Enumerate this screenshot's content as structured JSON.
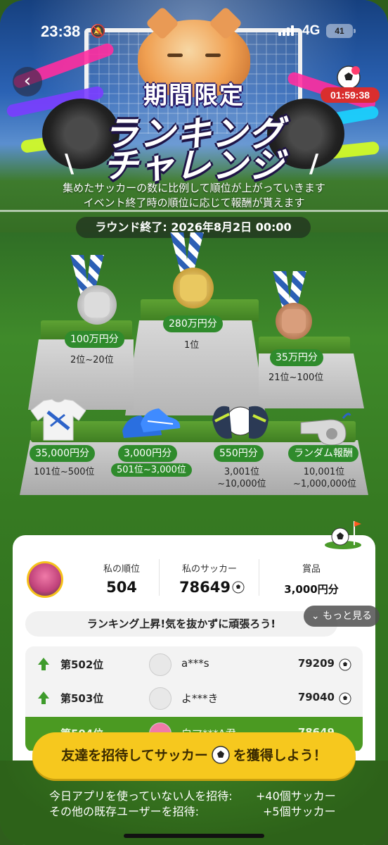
{
  "status_bar": {
    "time": "23:38",
    "network": "4G",
    "battery": "41"
  },
  "header": {
    "countdown": "01:59:38",
    "title_top": "期間限定",
    "title_line1": "ランキング",
    "title_line2": "チャレンジ",
    "desc_line1": "集めたサッカーの数に比例して順位が上がっていきます",
    "desc_line2": "イベント終了時の順位に応じて報酬が貰えます",
    "round_end": "ラウンド終了: 2026年8月2日 00:00"
  },
  "podium": [
    {
      "prize": "280万円分",
      "rank": "1位"
    },
    {
      "prize": "100万円分",
      "rank": "2位~20位"
    },
    {
      "prize": "35万円分",
      "rank": "21位~100位"
    }
  ],
  "rewards": [
    {
      "prize": "35,000円分",
      "rank": "101位~500位"
    },
    {
      "prize": "3,000円分",
      "rank": "501位~3,000位"
    },
    {
      "prize": "550円分",
      "rank_line1": "3,001位",
      "rank_line2": "~10,000位"
    },
    {
      "prize": "ランダム報酬",
      "rank_line1": "10,001位",
      "rank_line2": "~1,000,000位"
    }
  ],
  "my_status": {
    "rank_label": "私の順位",
    "rank_value": "504",
    "soccer_label": "私のサッカー",
    "soccer_value": "78649",
    "prize_label": "賞品",
    "prize_value": "3,000円分"
  },
  "cheer_message": "ランキング上昇!気を抜かずに頑張ろう!",
  "more_button": "もっと見る",
  "leaderboard": [
    {
      "rank": "第502位",
      "name": "a***s",
      "score": "79209"
    },
    {
      "rank": "第503位",
      "name": "よ***き",
      "score": "79040"
    },
    {
      "rank": "第504位",
      "name": "白マ***A君",
      "score": "78649"
    }
  ],
  "invite": {
    "before": "友達を招待してサッカー",
    "after": "を獲得しよう！"
  },
  "bonuses": [
    {
      "label": "今日アプリを使っていない人を招待:",
      "value": "+40個サッカー"
    },
    {
      "label": "その他の既存ユーザーを招待:",
      "value": "+5個サッカー"
    }
  ],
  "colors": {
    "accent_green": "#2f8b2c",
    "invite_yellow": "#f6c81e",
    "timer_red": "#d92e2e"
  }
}
